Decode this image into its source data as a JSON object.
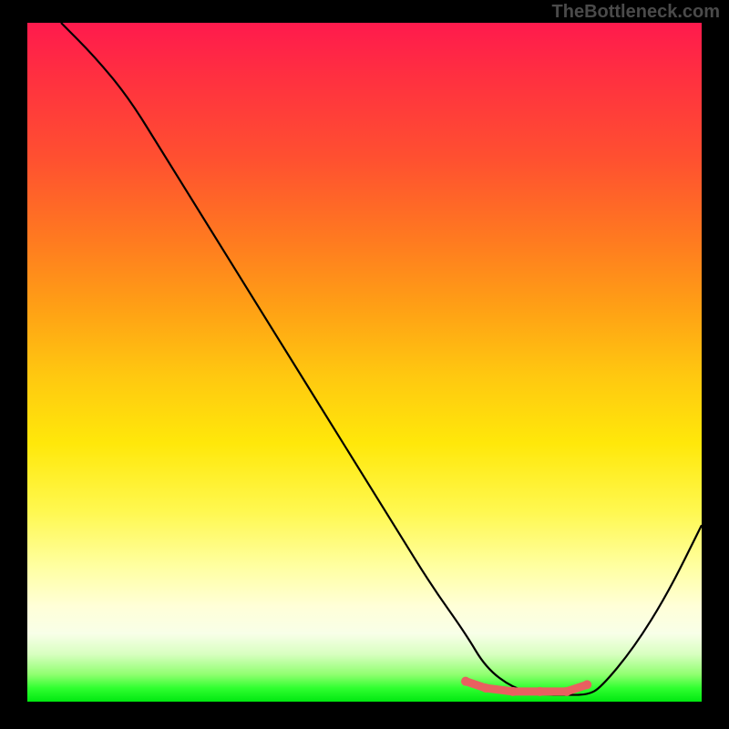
{
  "watermark": "TheBottleneck.com",
  "chart_data": {
    "type": "line",
    "title": "",
    "xlabel": "",
    "ylabel": "",
    "xlim": [
      0,
      100
    ],
    "ylim": [
      0,
      100
    ],
    "series": [
      {
        "name": "main-curve",
        "color": "#000000",
        "x": [
          5,
          10,
          15,
          20,
          25,
          30,
          35,
          40,
          45,
          50,
          55,
          60,
          65,
          68,
          72,
          76,
          80,
          83,
          85,
          90,
          95,
          100
        ],
        "y": [
          100,
          95,
          89,
          81,
          73,
          65,
          57,
          49,
          41,
          33,
          25,
          17,
          10,
          5,
          2,
          1,
          1,
          1,
          2,
          8,
          16,
          26
        ]
      },
      {
        "name": "highlight-segment",
        "color": "#e86060",
        "x": [
          65,
          68,
          72,
          76,
          80,
          83
        ],
        "y": [
          3,
          2,
          1.5,
          1.5,
          1.5,
          2.5
        ]
      }
    ],
    "gradient_stops": [
      {
        "pos": 0,
        "color": "#ff1a4d"
      },
      {
        "pos": 50,
        "color": "#ffd010"
      },
      {
        "pos": 85,
        "color": "#ffffc0"
      },
      {
        "pos": 100,
        "color": "#00e810"
      }
    ]
  }
}
